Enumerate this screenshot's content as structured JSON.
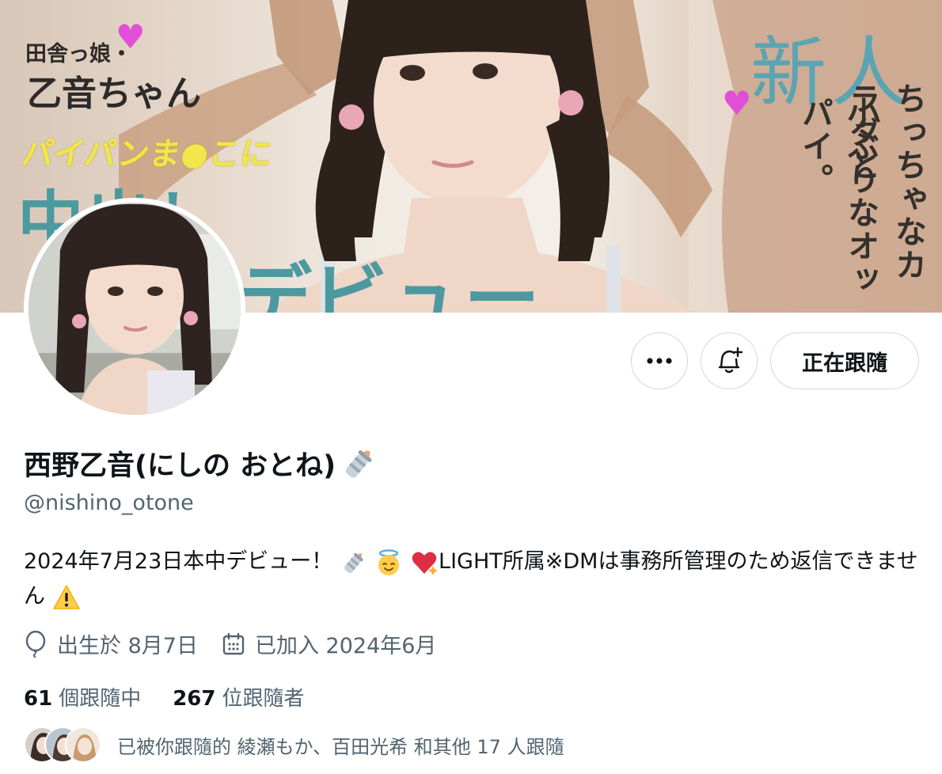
{
  "banner": {
    "line1": "田舎っ娘・",
    "line2": "乙音ちゃん",
    "line3": "パイパンま●こに",
    "big_left": "中出し",
    "big_bottom": "デビュー",
    "new_title": "新人",
    "vertical_right": "ちっちゃなカラダと",
    "vertical_left": "小ぶりなオッパイ。"
  },
  "profile": {
    "display_name": "西野乙音(にしの おとね)",
    "name_emoji": "baby-bottle-icon",
    "handle": "@nishino_otone",
    "bio_part1": "2024年7月23日本中デビュー！",
    "bio_part2": "LIGHT所属※DMは事務所管理のため返信できません",
    "birthday": "出生於 8月7日",
    "joined": "已加入 2024年6月"
  },
  "actions": {
    "more_icon": "more-dots-icon",
    "notify_icon": "bell-plus-icon",
    "follow_label": "正在跟隨"
  },
  "stats": {
    "following_count": "61",
    "following_label": "個跟隨中",
    "followers_count": "267",
    "followers_label": "位跟隨者"
  },
  "followed_by": {
    "text": "已被你跟隨的 綾瀬もか、百田光希 和其他 17 人跟隨"
  },
  "colors": {
    "text_primary": "#0f1419",
    "text_secondary": "#536471",
    "border": "#cfd9de",
    "heart": "#e24fd7",
    "banner_teal": "#4c9aa0"
  }
}
